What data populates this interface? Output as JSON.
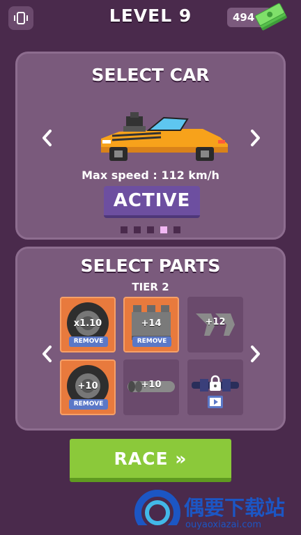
{
  "header": {
    "level_title": "LEVEL 9",
    "cash_amount": "494"
  },
  "car_panel": {
    "title": "SELECT CAR",
    "speed_label": "Max speed : 112 km/h",
    "status_button": "ACTIVE",
    "pager": {
      "total": 5,
      "active_index": 3
    },
    "car_color": "#f7a21b"
  },
  "parts_panel": {
    "title": "SELECT PARTS",
    "tier": "TIER 2",
    "parts": [
      {
        "name": "tire",
        "value": "x1.10",
        "equipped": true,
        "remove_label": "REMOVE"
      },
      {
        "name": "engine-block",
        "value": "+14",
        "equipped": true,
        "remove_label": "REMOVE"
      },
      {
        "name": "spoiler",
        "value": "+12",
        "equipped": false
      },
      {
        "name": "tire",
        "value": "+10",
        "equipped": true,
        "remove_label": "REMOVE"
      },
      {
        "name": "exhaust-pipe",
        "value": "+10",
        "equipped": false
      },
      {
        "name": "locked-part",
        "value": "",
        "equipped": false,
        "locked": true
      }
    ]
  },
  "race_button": {
    "label": "RACE »"
  },
  "watermark": {
    "text": "偶要下载站",
    "subtext": "ouyaoxiazai.com"
  },
  "colors": {
    "background": "#4a2a4c",
    "panel": "#7a5a7c",
    "equipped_part": "#e87a3d",
    "race_green": "#8bc93a",
    "active_purple": "#6d4fa0",
    "remove_blue": "#5b78c7"
  }
}
